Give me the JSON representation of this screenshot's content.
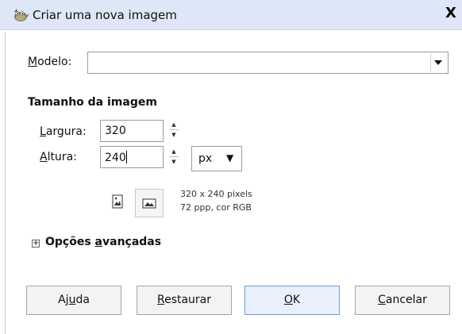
{
  "window": {
    "title": "Criar uma nova imagem",
    "close_label": "X"
  },
  "template": {
    "label": "Modelo:",
    "label_mnemonic": "M",
    "label_rest": "odelo:",
    "value": ""
  },
  "image_size": {
    "section_title": "Tamanho da imagem",
    "width": {
      "label_mnemonic": "L",
      "label_rest": "argura:",
      "value": "320"
    },
    "height": {
      "label_mnemonic": "A",
      "label_rest": "ltura:",
      "value": "240"
    },
    "unit": "px",
    "info_line1": "320 x 240 pixels",
    "info_line2": "72 ppp, cor RGB"
  },
  "advanced": {
    "expander_symbol": "+",
    "label_before": "Opções ",
    "label_mnemonic": "a",
    "label_after": "vançadas"
  },
  "buttons": {
    "help": {
      "before": "Aj",
      "mnemonic": "u",
      "after": "da"
    },
    "reset": {
      "before": "",
      "mnemonic": "R",
      "after": "estaurar"
    },
    "ok": {
      "before": "",
      "mnemonic": "O",
      "after": "K"
    },
    "cancel": {
      "before": "",
      "mnemonic": "C",
      "after": "ancelar"
    }
  },
  "icons": {
    "app": "gimp-wilber-icon",
    "portrait": "portrait-orientation-icon",
    "landscape": "landscape-orientation-icon",
    "dropdown": "dropdown-arrow-icon"
  },
  "colors": {
    "titlebar_bg": "#dde7f7",
    "default_button_border": "#6f9dd7"
  }
}
